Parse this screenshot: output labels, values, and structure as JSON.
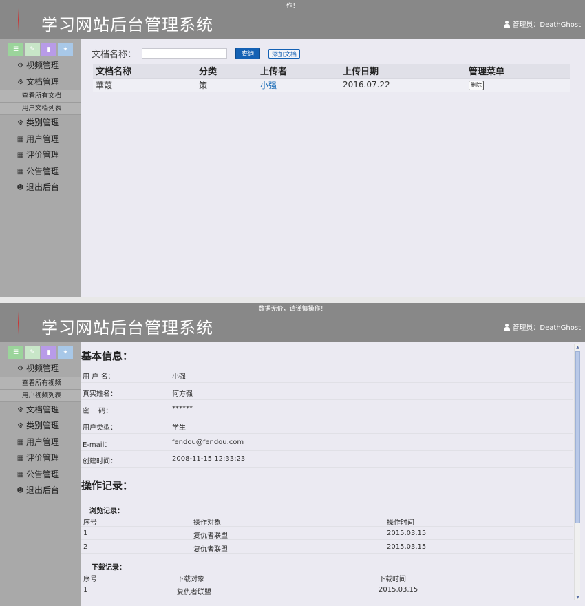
{
  "header1": {
    "notice": "作！",
    "title": "学习网站后台管理系统",
    "admin": "管理员：DeathGhost"
  },
  "header2": {
    "notice": "数据无价，请谨慎操作！",
    "title": "学习网站后台管理系统",
    "admin": "管理员：DeathGhost"
  },
  "toolbar_colors": [
    "#9bd49b",
    "#c8e6c8",
    "#b89be8",
    "#a8c8e8"
  ],
  "nav1": {
    "items": [
      "视频管理",
      "文档管理"
    ],
    "subs": [
      "查看所有文档",
      "用户文档列表"
    ],
    "items_after": [
      "类别管理",
      "用户管理",
      "评价管理",
      "公告管理",
      "退出后台"
    ]
  },
  "nav2": {
    "items": [
      "视频管理"
    ],
    "subs": [
      "查看所有视频",
      "用户视频列表"
    ],
    "items_after": [
      "文档管理",
      "类别管理",
      "用户管理",
      "评价管理",
      "公告管理",
      "退出后台"
    ]
  },
  "doc_page": {
    "search_label": "文档名称：",
    "search_value": "",
    "query_button": "查询",
    "add_button": "添加文档",
    "columns": [
      "文档名称",
      "分类",
      "上传者",
      "上传日期",
      "管理菜单"
    ],
    "rows": [
      {
        "name": "華葭",
        "category": "策",
        "uploader": "小强",
        "date": "2016.07.22",
        "action": "删除"
      }
    ]
  },
  "profile": {
    "basic_title": "基本信息：",
    "fields": [
      {
        "label": "用 户 名：",
        "value": "小强"
      },
      {
        "label": "真实姓名：",
        "value": "何方强"
      },
      {
        "label": "密　 码：",
        "value": "******"
      },
      {
        "label": "用户类型：",
        "value": "学生"
      },
      {
        "label": "E-mail：",
        "value": "fendou@fendou.com"
      },
      {
        "label": "创建时间：",
        "value": "2008-11-15 12:33:23"
      }
    ],
    "ops_title": "操作记录：",
    "browse_title": "浏览记录：",
    "browse_columns": [
      "序号",
      "操作对象",
      "操作时间"
    ],
    "browse_rows": [
      [
        "1",
        "复仇者联盟",
        "2015.03.15"
      ],
      [
        "2",
        "复仇者联盟",
        "2015.03.15"
      ]
    ],
    "download_title": "下载记录：",
    "download_columns": [
      "序号",
      "下载对象",
      "下载时间"
    ],
    "download_rows": [
      [
        "1",
        "复仇者联盟",
        "2015.03.15"
      ]
    ]
  }
}
